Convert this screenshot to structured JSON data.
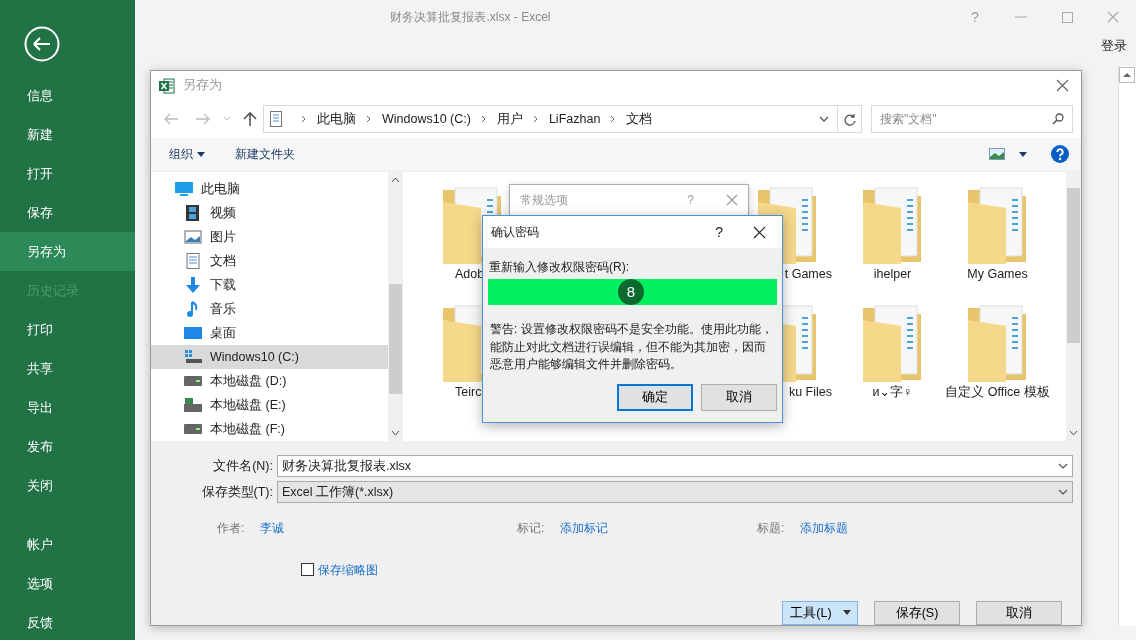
{
  "excel": {
    "title": "财务决算批复报表.xlsx - Excel",
    "help": "?",
    "signin": "登录"
  },
  "sidebar": {
    "items": [
      {
        "label": "信息",
        "selected": false,
        "disabled": false
      },
      {
        "label": "新建",
        "selected": false,
        "disabled": false
      },
      {
        "label": "打开",
        "selected": false,
        "disabled": false
      },
      {
        "label": "保存",
        "selected": false,
        "disabled": false
      },
      {
        "label": "另存为",
        "selected": true,
        "disabled": false
      },
      {
        "label": "历史记录",
        "selected": false,
        "disabled": true
      },
      {
        "label": "打印",
        "selected": false,
        "disabled": false
      },
      {
        "label": "共享",
        "selected": false,
        "disabled": false
      },
      {
        "label": "导出",
        "selected": false,
        "disabled": false
      },
      {
        "label": "发布",
        "selected": false,
        "disabled": false
      },
      {
        "label": "关闭",
        "selected": false,
        "disabled": false
      }
    ],
    "bottom_items": [
      {
        "label": "帐户",
        "selected": false,
        "disabled": false
      },
      {
        "label": "选项",
        "selected": false,
        "disabled": false
      },
      {
        "label": "反馈",
        "selected": false,
        "disabled": false
      }
    ]
  },
  "save_dialog": {
    "title": "另存为",
    "breadcrumb": [
      "此电脑",
      "Windows10 (C:)",
      "用户",
      "LiFazhan",
      "文档"
    ],
    "search": {
      "placeholder": "搜索\"文档\""
    },
    "toolbar": {
      "organize": "组织",
      "new_folder": "新建文件夹"
    },
    "nav_tree": [
      {
        "label": "此电脑",
        "kind": "pc",
        "selected": false,
        "children": [
          {
            "label": "视频",
            "kind": "video",
            "selected": false
          },
          {
            "label": "图片",
            "kind": "pictures",
            "selected": false
          },
          {
            "label": "文档",
            "kind": "documents",
            "selected": false
          },
          {
            "label": "下载",
            "kind": "download",
            "selected": false
          },
          {
            "label": "音乐",
            "kind": "music",
            "selected": false
          },
          {
            "label": "桌面",
            "kind": "desktop",
            "selected": false
          },
          {
            "label": "Windows10 (C:)",
            "kind": "system_drive",
            "selected": true
          },
          {
            "label": "本地磁盘 (D:)",
            "kind": "drive",
            "selected": false
          },
          {
            "label": "本地磁盘 (E:)",
            "kind": "network_drive",
            "selected": false
          },
          {
            "label": "本地磁盘 (F:)",
            "kind": "drive",
            "selected": false
          }
        ]
      }
    ],
    "file_columns": [
      [
        {
          "name": "Adob"
        },
        {
          "name": "Teirc"
        }
      ],
      [
        {
          "name": "t Games"
        },
        {
          "name": "ku Files"
        }
      ],
      [
        {
          "name": "ihelper"
        },
        {
          "name": "и⌄字♀"
        }
      ],
      [
        {
          "name": "My Games"
        },
        {
          "name": "自定义 Office 模板"
        }
      ]
    ],
    "file_name": {
      "label": "文件名(N):",
      "value": "财务决算批复报表.xlsx"
    },
    "file_type": {
      "label": "保存类型(T):",
      "value": "Excel 工作簿(*.xlsx)"
    },
    "metadata": [
      {
        "label": "作者:",
        "value": "李诚"
      },
      {
        "label": "标记:",
        "value": "添加标记"
      },
      {
        "label": "标题:",
        "value": "添加标题"
      }
    ],
    "thumbnail": {
      "label": "保存缩略图",
      "checked": false
    },
    "buttons": [
      {
        "label": "工具(L)",
        "kind": "menu",
        "selected": true
      },
      {
        "label": "保存(S)",
        "kind": "plain",
        "selected": false
      },
      {
        "label": "取消",
        "kind": "plain",
        "selected": false
      }
    ]
  },
  "general_options_dialog": {
    "title": "常规选项",
    "help": "?"
  },
  "confirm_dialog": {
    "title": "确认密码",
    "help": "?",
    "prompt": "重新输入修改权限密码(R):",
    "step_badge": "8",
    "warning": "警告: 设置修改权限密码不是安全功能。使用此功能，能防止对此文档进行误编辑，但不能为其加密，因而恶意用户能够编辑文件并删除密码。",
    "buttons": [
      {
        "label": "确定",
        "default": true
      },
      {
        "label": "取消",
        "default": false
      }
    ]
  }
}
